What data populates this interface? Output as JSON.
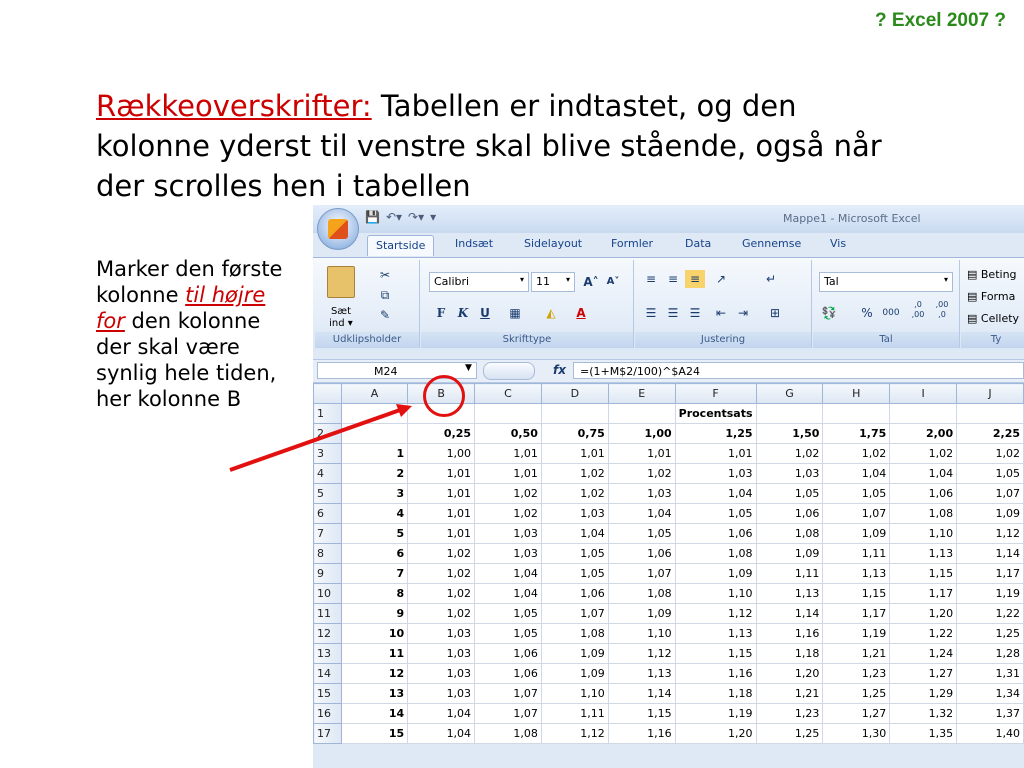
{
  "slide": {
    "corner_title": "? Excel 2007 ?",
    "heading_highlight": "Rækkeoverskrifter:",
    "heading_rest": " Tabellen er indtastet, og den kolonne yderst til venstre skal blive stående, også når der scrolles hen i tabellen",
    "side_text_1": "Marker den første kolonne ",
    "side_text_red": "til højre for",
    "side_text_2": " den kolonne der skal være synlig hele tiden, her kolonne B"
  },
  "excel": {
    "window_title": "Mappe1 - Microsoft Excel",
    "tabs": [
      "Startside",
      "Indsæt",
      "Sidelayout",
      "Formler",
      "Data",
      "Gennemse",
      "Vis"
    ],
    "active_tab": "Startside",
    "ribbon": {
      "clipboard": {
        "paste_label_1": "Sæt",
        "paste_label_2": "ind ▾",
        "group": "Udklipsholder"
      },
      "font": {
        "font_name": "Calibri",
        "font_size": "11",
        "bold": "F",
        "italic": "K",
        "underline": "U",
        "group": "Skrifttype"
      },
      "alignment": {
        "group": "Justering"
      },
      "number": {
        "format": "Tal",
        "percent": "%",
        "thousands": "000",
        "inc_decimals": ",0 ,00",
        "dec_decimals": ",00 ,0",
        "group": "Tal"
      },
      "styles": {
        "item1": "Beting",
        "item2": "Forma",
        "item3": "Cellety",
        "group": "Ty"
      }
    },
    "name_box": "M24",
    "fx_label": "fx",
    "formula": "=(1+M$2/100)^$A24",
    "columns": [
      "A",
      "B",
      "C",
      "D",
      "E",
      "F",
      "G",
      "H",
      "I",
      "J"
    ],
    "row1_label": "Procentsats",
    "row2": [
      "0,25",
      "0,50",
      "0,75",
      "1,00",
      "1,25",
      "1,50",
      "1,75",
      "2,00",
      "2,25"
    ],
    "rows": [
      {
        "n": "3",
        "a": "1",
        "v": [
          "1,00",
          "1,01",
          "1,01",
          "1,01",
          "1,01",
          "1,02",
          "1,02",
          "1,02",
          "1,02"
        ]
      },
      {
        "n": "4",
        "a": "2",
        "v": [
          "1,01",
          "1,01",
          "1,02",
          "1,02",
          "1,03",
          "1,03",
          "1,04",
          "1,04",
          "1,05"
        ]
      },
      {
        "n": "5",
        "a": "3",
        "v": [
          "1,01",
          "1,02",
          "1,02",
          "1,03",
          "1,04",
          "1,05",
          "1,05",
          "1,06",
          "1,07"
        ]
      },
      {
        "n": "6",
        "a": "4",
        "v": [
          "1,01",
          "1,02",
          "1,03",
          "1,04",
          "1,05",
          "1,06",
          "1,07",
          "1,08",
          "1,09"
        ]
      },
      {
        "n": "7",
        "a": "5",
        "v": [
          "1,01",
          "1,03",
          "1,04",
          "1,05",
          "1,06",
          "1,08",
          "1,09",
          "1,10",
          "1,12"
        ]
      },
      {
        "n": "8",
        "a": "6",
        "v": [
          "1,02",
          "1,03",
          "1,05",
          "1,06",
          "1,08",
          "1,09",
          "1,11",
          "1,13",
          "1,14"
        ]
      },
      {
        "n": "9",
        "a": "7",
        "v": [
          "1,02",
          "1,04",
          "1,05",
          "1,07",
          "1,09",
          "1,11",
          "1,13",
          "1,15",
          "1,17"
        ]
      },
      {
        "n": "10",
        "a": "8",
        "v": [
          "1,02",
          "1,04",
          "1,06",
          "1,08",
          "1,10",
          "1,13",
          "1,15",
          "1,17",
          "1,19"
        ]
      },
      {
        "n": "11",
        "a": "9",
        "v": [
          "1,02",
          "1,05",
          "1,07",
          "1,09",
          "1,12",
          "1,14",
          "1,17",
          "1,20",
          "1,22"
        ]
      },
      {
        "n": "12",
        "a": "10",
        "v": [
          "1,03",
          "1,05",
          "1,08",
          "1,10",
          "1,13",
          "1,16",
          "1,19",
          "1,22",
          "1,25"
        ]
      },
      {
        "n": "13",
        "a": "11",
        "v": [
          "1,03",
          "1,06",
          "1,09",
          "1,12",
          "1,15",
          "1,18",
          "1,21",
          "1,24",
          "1,28"
        ]
      },
      {
        "n": "14",
        "a": "12",
        "v": [
          "1,03",
          "1,06",
          "1,09",
          "1,13",
          "1,16",
          "1,20",
          "1,23",
          "1,27",
          "1,31"
        ]
      },
      {
        "n": "15",
        "a": "13",
        "v": [
          "1,03",
          "1,07",
          "1,10",
          "1,14",
          "1,18",
          "1,21",
          "1,25",
          "1,29",
          "1,34"
        ]
      },
      {
        "n": "16",
        "a": "14",
        "v": [
          "1,04",
          "1,07",
          "1,11",
          "1,15",
          "1,19",
          "1,23",
          "1,27",
          "1,32",
          "1,37"
        ]
      },
      {
        "n": "17",
        "a": "15",
        "v": [
          "1,04",
          "1,08",
          "1,12",
          "1,16",
          "1,20",
          "1,25",
          "1,30",
          "1,35",
          "1,40"
        ]
      }
    ]
  },
  "colors": {
    "accent_red": "#cc0000",
    "corner_green": "#2a8a1a",
    "annotation_red": "#e31010"
  }
}
